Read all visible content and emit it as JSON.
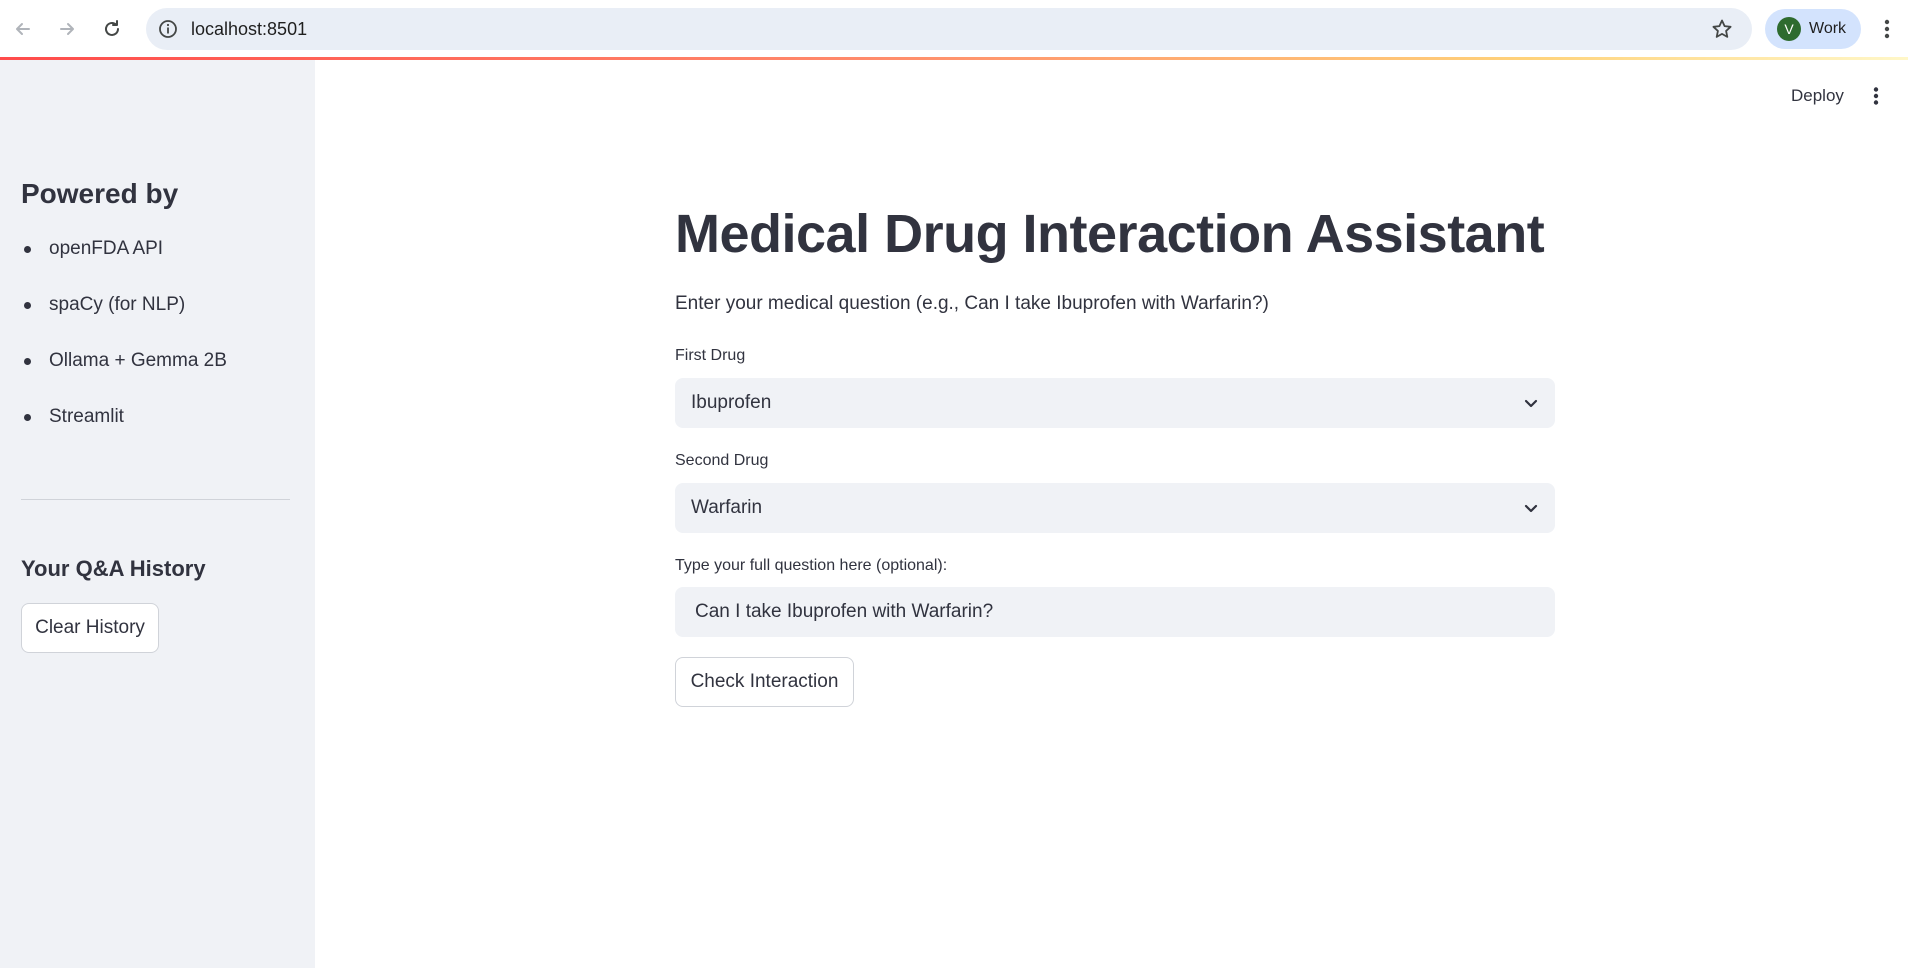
{
  "browser": {
    "url": "localhost:8501",
    "profile_initial": "V",
    "profile_label": "Work"
  },
  "toolbar": {
    "deploy_label": "Deploy"
  },
  "sidebar": {
    "heading": "Powered by",
    "items": [
      {
        "label": "openFDA API"
      },
      {
        "label": "spaCy (for NLP)"
      },
      {
        "label": "Ollama + Gemma 2B"
      },
      {
        "label": "Streamlit"
      }
    ],
    "history_heading": "Your Q&A History",
    "clear_history_label": "Clear History"
  },
  "main": {
    "title": "Medical Drug Interaction Assistant",
    "subtitle": "Enter your medical question (e.g., Can I take Ibuprofen with Warfarin?)",
    "first_drug": {
      "label": "First Drug",
      "value": "Ibuprofen"
    },
    "second_drug": {
      "label": "Second Drug",
      "value": "Warfarin"
    },
    "question": {
      "label": "Type your full question here (optional):",
      "value": "Can I take Ibuprofen with Warfarin?"
    },
    "check_label": "Check Interaction"
  },
  "colors": {
    "accent": "#ff4b4b",
    "sidebar_bg": "#f0f2f6",
    "text": "#31333f"
  }
}
